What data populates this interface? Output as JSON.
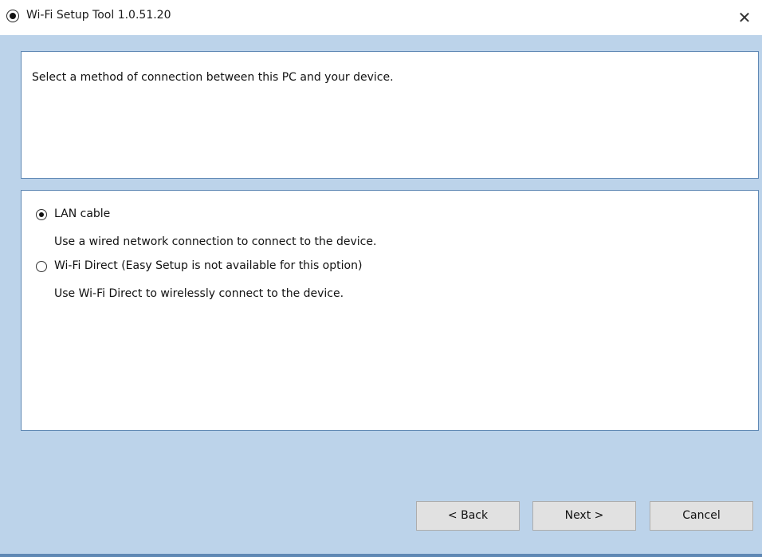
{
  "window": {
    "title": "Wi-Fi Setup Tool 1.0.51.20",
    "app_icon": "radio-circle-icon",
    "close_glyph": "✕"
  },
  "header": {
    "instruction": "Select a method of connection between this PC and your device."
  },
  "options": [
    {
      "label": "LAN cable",
      "description": "Use a wired network connection to connect to the device.",
      "selected": true
    },
    {
      "label": "Wi-Fi Direct (Easy Setup is not available for this option)",
      "description": "Use Wi-Fi Direct to wirelessly connect to the device.",
      "selected": false
    }
  ],
  "buttons": {
    "back": "< Back",
    "next": "Next >",
    "cancel": "Cancel"
  },
  "colors": {
    "client_background": "#bcd3ea",
    "panel_border": "#5f88b4",
    "button_face": "#e1e1e1"
  }
}
